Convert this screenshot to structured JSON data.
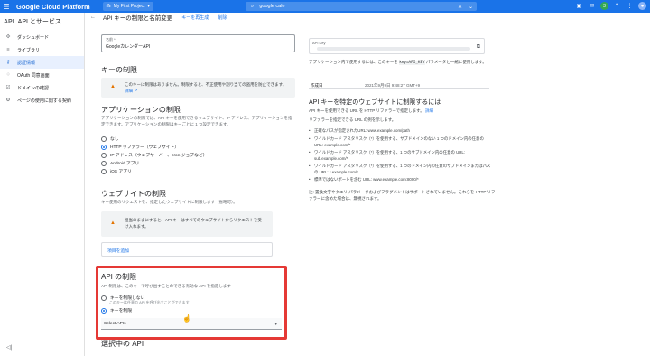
{
  "topbar": {
    "menu_icon": "menu-icon",
    "brand": "Google Cloud Platform",
    "project": "My First Project",
    "search_value": "google cale",
    "colors": {
      "bar": "#1a73e8"
    }
  },
  "sidebar": {
    "logo": "API",
    "title": "API とサービス",
    "items": [
      {
        "label": "ダッシュボード",
        "icon": "dashboard-icon"
      },
      {
        "label": "ライブラリ",
        "icon": "library-icon"
      },
      {
        "label": "認証情報",
        "icon": "key-icon"
      },
      {
        "label": "OAuth 同意画面",
        "icon": "oauth-icon"
      },
      {
        "label": "ドメインの確認",
        "icon": "checkbox-icon"
      },
      {
        "label": "ページの使用に関する契約",
        "icon": "settings-icon"
      }
    ],
    "active_index": 2
  },
  "pagebar": {
    "title": "API キーの制限と名前変更",
    "action1": "キーを再生成",
    "action2": "削除"
  },
  "form": {
    "name_label": "名前 *",
    "name_value": "GoogleカレンダーAPI",
    "key_restriction_heading": "キーの制限",
    "key_warning": "このキーに制限はありません。制限すると、不正使用や割り当ての盗用を防止できます。",
    "key_warning_link": "詳細",
    "app_heading": "アプリケーションの制限",
    "app_desc": "アプリケーションの制限では、API キーを使用できるウェブサイト、IP アドレス、アプリケーションを指定できます。アプリケーションの制限はキーごとに 1 つ設定できます。",
    "app_options": [
      "なし",
      "HTTP リファラー（ウェブサイト）",
      "IP アドレス（ウェブサーバー、cron ジョブなど）",
      "Android アプリ",
      "iOS アプリ"
    ],
    "app_selected": 1,
    "web_heading": "ウェブサイトの制限",
    "web_desc": "キー使用のリクエストを、指定したウェブサイトに制限します（省略可）。",
    "web_warning": "担当のままにすると、API キーはすべてのウェブサイトからリクエストを受け入れます。",
    "add_item": "項目を追加",
    "api_heading": "API の制限",
    "api_desc": "API 制限は、このキーで呼び出すことのできる有効な API を指定します",
    "api_opt1": "キーを制限しない",
    "api_opt1_sub": "このキーは任意の API を呼び出すことができます",
    "api_opt2": "キーを制限",
    "select_value": "Select APIs",
    "selected_heading": "選択中の API"
  },
  "info": {
    "api_key_label": "API Key",
    "use_text_1": "アプリケーション内で使用するには、このキーを",
    "use_code": "key=API_KEY",
    "use_text_2": "パラメータと一緒に使用します。",
    "created_label": "作成日",
    "created_value": "2021年9月9日 9:48:27 GMT+9",
    "heading": "API キーを特定のウェブサイトに制限するには",
    "p1": "API キーを使用できる URL を HTTP リファラーで指定します。",
    "p1_link": "詳細",
    "p2": "リファラーを指定できる URL の例を示します。",
    "bullets": [
      "正確なパスが指定されたURL: www.example.com/path",
      "ワイルドカード アスタリスク（*）を使用する、サブドメインのない 1 つのドメイン内の任意の URL: example.com/*",
      "ワイルドカード アスタリスク（*）を使用する、1 つのサブドメイン内の任意の URL: sub.example.com/*",
      "ワイルドカード アスタリスク（*）を使用する、1 つのドメイン内の任意のサブドメインまたはパスの URL: *.example.com/*",
      "標準ではないポートを含む URL: www.example.com:8000/*"
    ],
    "note": "注: 置換文字やクエリ パラメータおよびフラグメントはサポートされていません。これらを HTTP リファラーに含めた場合は、無視されます。"
  },
  "highlight_color": "#e53935"
}
